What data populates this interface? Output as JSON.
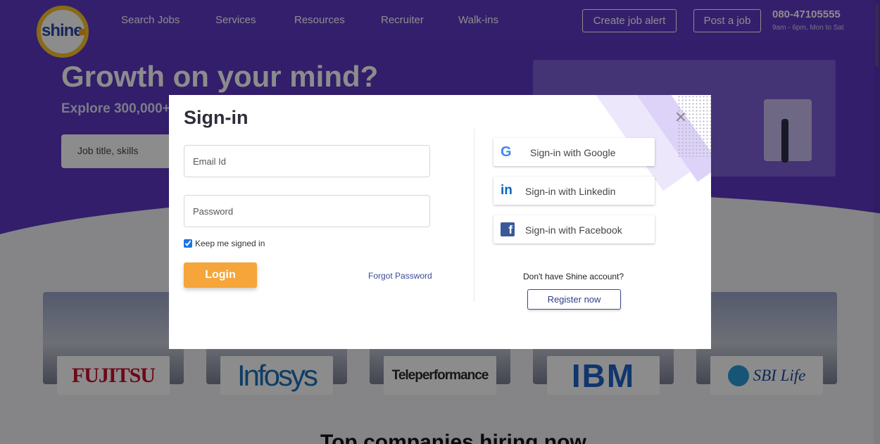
{
  "header": {
    "logo_text": "shine",
    "nav": [
      "Search Jobs",
      "Services",
      "Resources",
      "Recruiter",
      "Walk-ins"
    ],
    "create_alert": "Create job alert",
    "post_job": "Post a job",
    "phone": "080-47105555",
    "hours": "9am - 6pm, Mon to Sat"
  },
  "hero": {
    "title": "Growth on your mind?",
    "subtitle": "Explore 300,000+",
    "search_placeholder": "Job title, skills"
  },
  "companies": [
    "FUJITSU",
    "Infosys",
    "Teleperformance",
    "IBM",
    "SBI Life"
  ],
  "section_heading": "Top companies hiring now",
  "modal": {
    "title": "Sign-in",
    "email_placeholder": "Email Id",
    "password_placeholder": "Password",
    "keep_signed_in": "Keep me signed in",
    "keep_checked": true,
    "login": "Login",
    "forgot": "Forgot Password",
    "google": "Sign-in with Google",
    "linkedin": "Sign-in with Linkedin",
    "facebook": "Sign-in with Facebook",
    "no_account": "Don't have Shine account?",
    "register": "Register now"
  },
  "icons": {
    "close": "close-icon",
    "google": "google-icon",
    "linkedin": "linkedin-icon",
    "facebook": "facebook-icon"
  },
  "colors": {
    "header_bg": "#5f3ac6",
    "login_button": "#f5a53a",
    "register_border": "#3b4a8a"
  }
}
